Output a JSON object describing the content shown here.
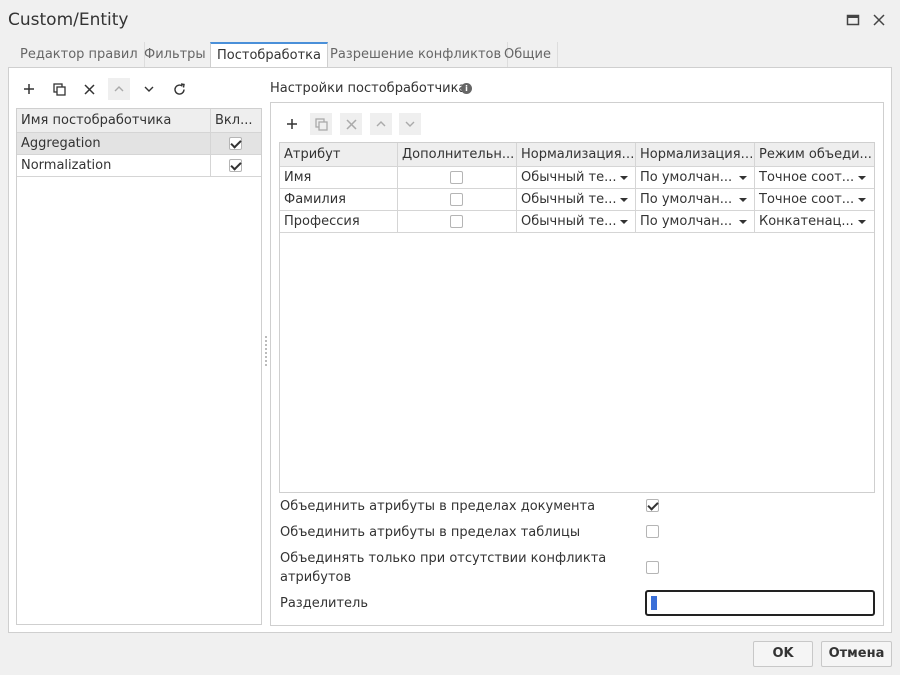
{
  "window": {
    "title": "Custom/Entity"
  },
  "tabs": [
    {
      "label": "Редактор правил"
    },
    {
      "label": "Фильтры"
    },
    {
      "label": "Постобработка"
    },
    {
      "label": "Разрешение конфликтов"
    },
    {
      "label": "Общие"
    }
  ],
  "left_panel": {
    "columns": [
      "Имя постобработчика",
      "Вкл..."
    ],
    "rows": [
      {
        "name": "Aggregation",
        "enabled": true,
        "selected": true
      },
      {
        "name": "Normalization",
        "enabled": true,
        "selected": false
      }
    ]
  },
  "right_panel": {
    "title": "Настройки постобработчика",
    "columns": [
      "Атрибут",
      "Дополнительн...",
      "Нормализация ...",
      "Нормализация ...",
      "Режим объеди..."
    ],
    "rows": [
      {
        "attribute": "Имя",
        "additional": false,
        "norm1": "Обычный те...",
        "norm2": "По умолчан...",
        "merge": "Точное соот..."
      },
      {
        "attribute": "Фамилия",
        "additional": false,
        "norm1": "Обычный те...",
        "norm2": "По умолчан...",
        "merge": "Точное соот..."
      },
      {
        "attribute": "Профессия",
        "additional": false,
        "norm1": "Обычный те...",
        "norm2": "По умолчан...",
        "merge": "Конкатенац..."
      }
    ]
  },
  "options": {
    "merge_document": {
      "label": "Объединить атрибуты в пределах документа",
      "checked": true
    },
    "merge_table": {
      "label": "Объединить атрибуты в пределах таблицы",
      "checked": false
    },
    "merge_no_conflict": {
      "label_line1": "Объединять только при отсутствии конфликта",
      "label_line2": "атрибутов",
      "checked": false
    },
    "separator": {
      "label": "Разделитель",
      "value": " "
    }
  },
  "footer": {
    "ok_label": "OK",
    "cancel_label": "Отмена"
  },
  "colors": {
    "accent": "#4a90d9",
    "selected_row": "#e3e3e3",
    "header_bg": "#eeeeee"
  }
}
